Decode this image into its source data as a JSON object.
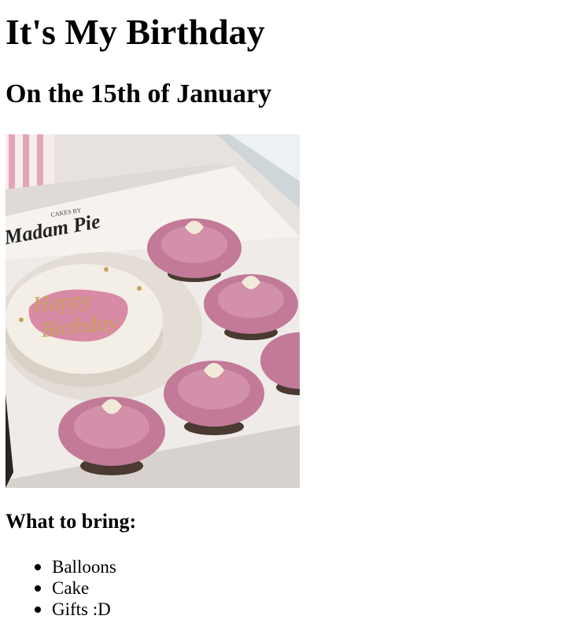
{
  "heading": {
    "title": "It's My Birthday",
    "subtitle": "On the 15th of January"
  },
  "image": {
    "alt": "",
    "box_text": "Madam Pie",
    "box_small": "CAKES BY",
    "cake_text_1": "Happy",
    "cake_text_2": "Birthday"
  },
  "bring": {
    "title": "What to bring:",
    "items": [
      {
        "label": "Balloons"
      },
      {
        "label": "Cake"
      },
      {
        "label": "Gifts :D"
      }
    ]
  },
  "colors": {
    "text": "#000000",
    "background": "#ffffff",
    "frosting": "#c0809a",
    "cake": "#f4efe6",
    "box": "#f3efec"
  }
}
